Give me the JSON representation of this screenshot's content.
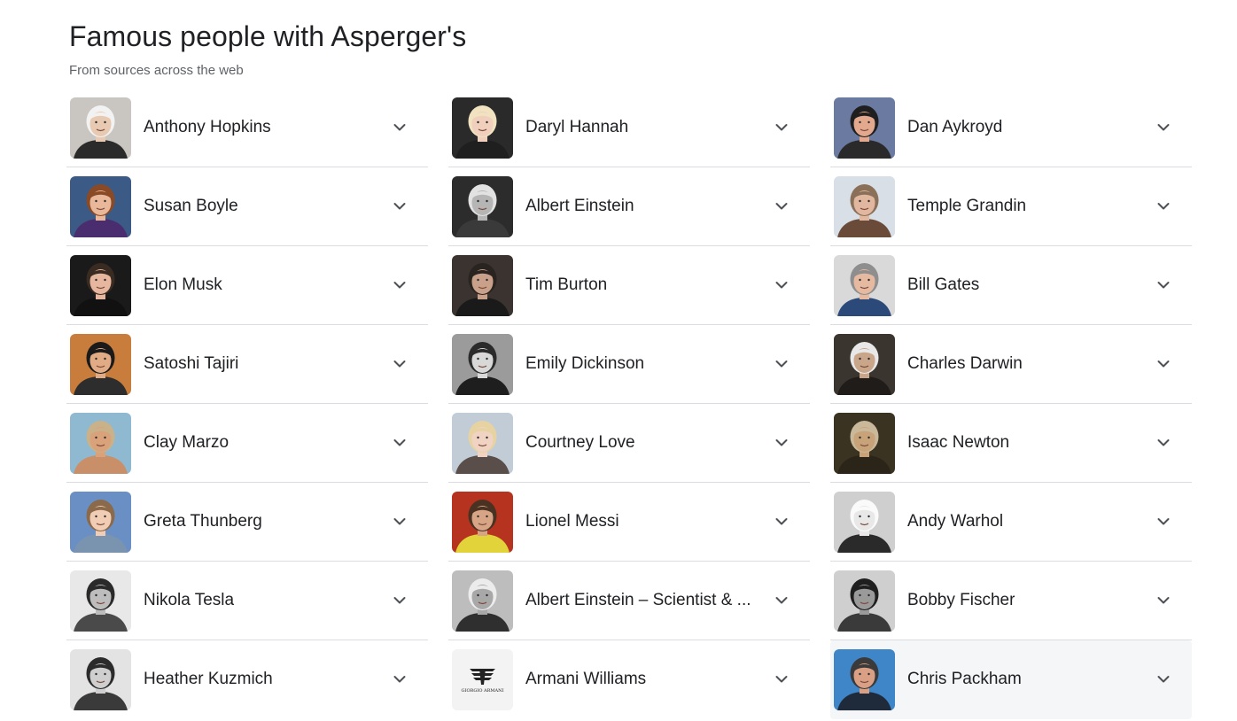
{
  "header": {
    "title": "Famous people with Asperger's",
    "subtitle": "From sources across the web"
  },
  "icons": {
    "expand": "chevron-down-icon"
  },
  "columns": [
    [
      {
        "name": "Anthony Hopkins",
        "bg": "#c9c5c0",
        "face": "#e8c9b2",
        "hair": "#f2f2f2",
        "shirt": "#2b2b2b"
      },
      {
        "name": "Susan Boyle",
        "bg": "#3c5a86",
        "face": "#e9b79a",
        "hair": "#8a4a26",
        "shirt": "#4a2d6e"
      },
      {
        "name": "Elon Musk",
        "bg": "#1a1a1a",
        "face": "#e6b79e",
        "hair": "#3a2b22",
        "shirt": "#111111"
      },
      {
        "name": "Satoshi Tajiri",
        "bg": "#c97d3c",
        "face": "#e0ab85",
        "hair": "#1a1a1a",
        "shirt": "#2d2d2d"
      },
      {
        "name": "Clay Marzo",
        "bg": "#8fb9d1",
        "face": "#d9a27b",
        "hair": "#c9b18a",
        "shirt": "#c98f68"
      },
      {
        "name": "Greta Thunberg",
        "bg": "#6a8fc4",
        "face": "#f2cdb5",
        "hair": "#8a6a4a",
        "shirt": "#7a94b0"
      },
      {
        "name": "Nikola Tesla",
        "bg": "#e8e8e8",
        "face": "#bdbdbd",
        "hair": "#2a2a2a",
        "shirt": "#4a4a4a"
      },
      {
        "name": "Heather Kuzmich",
        "bg": "#e3e3e3",
        "face": "#cfcfcf",
        "hair": "#2b2b2b",
        "shirt": "#3a3a3a"
      }
    ],
    [
      {
        "name": "Daryl Hannah",
        "bg": "#2a2a2a",
        "face": "#f0cfbd",
        "hair": "#f1e2c0",
        "shirt": "#1f1f1f"
      },
      {
        "name": "Albert Einstein",
        "bg": "#2c2c2c",
        "face": "#b5b5b5",
        "hair": "#e2e2e2",
        "shirt": "#3a3a3a"
      },
      {
        "name": "Tim Burton",
        "bg": "#3a3330",
        "face": "#c9a08a",
        "hair": "#2a2420",
        "shirt": "#1a1a1a"
      },
      {
        "name": "Emily Dickinson",
        "bg": "#9b9b9b",
        "face": "#d8d8d8",
        "hair": "#2b2b2b",
        "shirt": "#1e1e1e"
      },
      {
        "name": "Courtney Love",
        "bg": "#c2ccd6",
        "face": "#f1d3c4",
        "hair": "#e7d3a2",
        "shirt": "#5a4e4a"
      },
      {
        "name": "Lionel Messi",
        "bg": "#b5331f",
        "face": "#d7a585",
        "hair": "#4a3222",
        "shirt": "#e2d33a"
      },
      {
        "name": "Albert Einstein – Scientist & ...",
        "bg": "#bdbdbd",
        "face": "#a8a8a8",
        "hair": "#ececec",
        "shirt": "#2f2f2f"
      },
      {
        "name": "Armani Williams",
        "bg": "#f3f3f3",
        "face": "#f3f3f3",
        "hair": "#f3f3f3",
        "shirt": "#f3f3f3",
        "logo_top": "GIORGIO ARMANI"
      }
    ],
    [
      {
        "name": "Dan Aykroyd",
        "bg": "#6b7aa0",
        "face": "#e2a98e",
        "hair": "#1f1f1f",
        "shirt": "#2a2a2a"
      },
      {
        "name": "Temple Grandin",
        "bg": "#d9dfe6",
        "face": "#e2b79f",
        "hair": "#8a7058",
        "shirt": "#6a4b3a"
      },
      {
        "name": "Bill Gates",
        "bg": "#d9d9d9",
        "face": "#e6b9a1",
        "hair": "#8e8e8e",
        "shirt": "#2b4a7a"
      },
      {
        "name": "Charles Darwin",
        "bg": "#3b3530",
        "face": "#c9a58a",
        "hair": "#e8e8e8",
        "shirt": "#1f1c1a"
      },
      {
        "name": "Isaac Newton",
        "bg": "#3a3322",
        "face": "#c8a37a",
        "hair": "#c9b89a",
        "shirt": "#2b2418"
      },
      {
        "name": "Andy Warhol",
        "bg": "#cfcfcf",
        "face": "#e8e8e8",
        "hair": "#fafafa",
        "shirt": "#2a2a2a"
      },
      {
        "name": "Bobby Fischer",
        "bg": "#cfcfcf",
        "face": "#9a9a9a",
        "hair": "#1f1f1f",
        "shirt": "#3a3a3a"
      },
      {
        "name": "Chris Packham",
        "bg": "#3f86c9",
        "face": "#d9a085",
        "hair": "#3a3a3a",
        "shirt": "#1f2a3a"
      }
    ]
  ]
}
